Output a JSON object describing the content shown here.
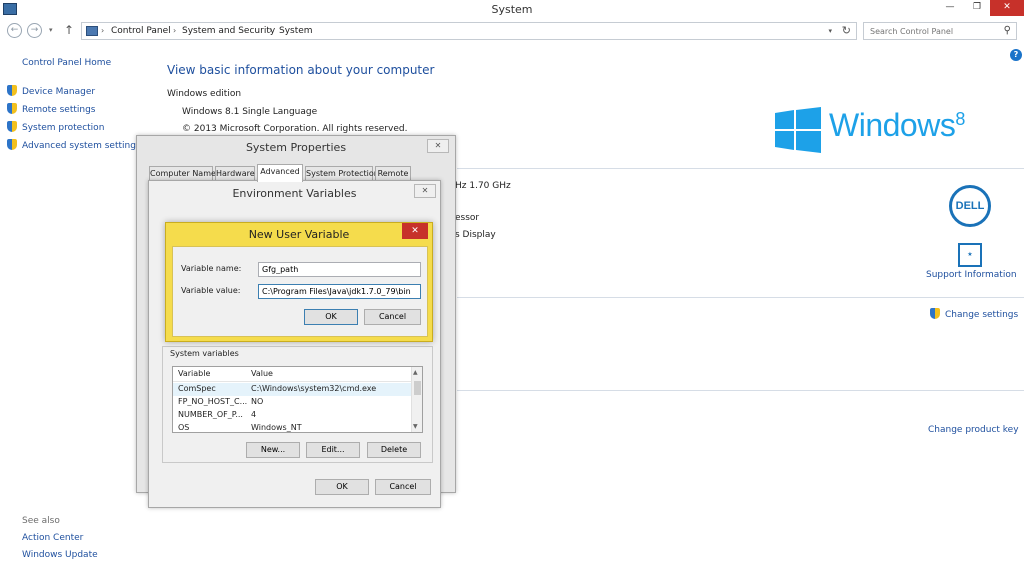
{
  "window": {
    "title": "System",
    "min_symbol": "—",
    "max_symbol": "❐",
    "close_symbol": "✕"
  },
  "nav": {
    "back_symbol": "←",
    "forward_symbol": "→",
    "up_symbol": "↑",
    "breadcrumbs": [
      "Control Panel",
      "System and Security",
      "System"
    ],
    "separator": "›",
    "search_placeholder": "Search Control Panel",
    "search_symbol": "⚲",
    "help_symbol": "?"
  },
  "left_pane": {
    "home": "Control Panel Home",
    "links": [
      "Device Manager",
      "Remote settings",
      "System protection",
      "Advanced system settings"
    ],
    "see_also_label": "See also",
    "see_also_links": [
      "Action Center",
      "Windows Update"
    ]
  },
  "main": {
    "heading": "View basic information about your computer",
    "edition_section": "Windows edition",
    "edition": "Windows 8.1 Single Language",
    "copyright": "© 2013 Microsoft Corporation. All rights reserved.",
    "cpu_fragment": "Hz   1.70 GHz",
    "processor_fragment": "essor",
    "display_fragment": "s Display",
    "windows_logo_text": "Windows",
    "windows_logo_version": "8",
    "dell_logo": "DELL",
    "support_link": "Support Information",
    "change_settings": "Change settings",
    "change_product_key": "Change product key"
  },
  "system_properties": {
    "title": "System Properties",
    "close_symbol": "✕",
    "tabs": [
      "Computer Name",
      "Hardware",
      "Advanced",
      "System Protection",
      "Remote"
    ],
    "active_tab": "Advanced"
  },
  "env_vars": {
    "title": "Environment Variables",
    "close_symbol": "✕",
    "system_variables_label": "System variables",
    "columns": [
      "Variable",
      "Value"
    ],
    "rows": [
      {
        "variable": "ComSpec",
        "value": "C:\\Windows\\system32\\cmd.exe"
      },
      {
        "variable": "FP_NO_HOST_C...",
        "value": "NO"
      },
      {
        "variable": "NUMBER_OF_P...",
        "value": "4"
      },
      {
        "variable": "OS",
        "value": "Windows_NT"
      }
    ],
    "buttons": {
      "new": "New...",
      "edit": "Edit...",
      "delete": "Delete"
    },
    "ok": "OK",
    "cancel": "Cancel"
  },
  "new_user_variable": {
    "title": "New User Variable",
    "close_symbol": "✕",
    "name_label": "Variable name:",
    "name_value": "Gfg_path",
    "value_label": "Variable value:",
    "value_value": "C:\\Program Files\\Java\\jdk1.7.0_79\\bin",
    "ok": "OK",
    "cancel": "Cancel"
  },
  "colors": {
    "link": "#1e4f9e",
    "windows_blue": "#1da1e8",
    "dialog_accent": "#f5dc4c",
    "close_red": "#c7312a"
  }
}
